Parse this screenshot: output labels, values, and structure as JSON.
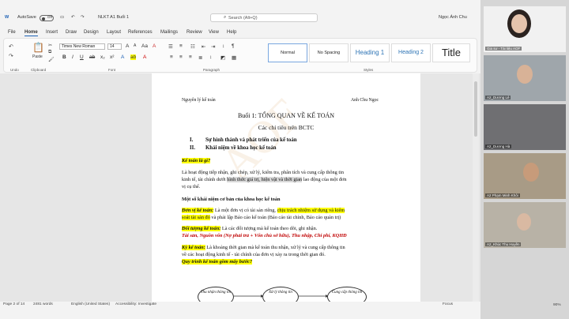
{
  "titlebar": {
    "autosave": "AutoSave",
    "autosave_state": "Off",
    "doc_title": "NLKT A1 Buổi 1",
    "search_placeholder": "Search (Alt+Q)",
    "user": "Ngọc Ánh Chu"
  },
  "menu": [
    "File",
    "Home",
    "Insert",
    "Draw",
    "Design",
    "Layout",
    "References",
    "Mailings",
    "Review",
    "View",
    "Help"
  ],
  "ribbon": {
    "paste": "Paste",
    "font_name": "Times New Roman",
    "font_size": "14",
    "styles": [
      "Normal",
      "No Spacing",
      "Heading 1",
      "Heading 2",
      "Title"
    ],
    "groups": [
      "Undo",
      "Clipboard",
      "Font",
      "Paragraph",
      "Styles"
    ]
  },
  "document": {
    "header_left": "Nguyên lý kế toán",
    "header_right": "Anh Chu Ngọc",
    "title": "Buổi 1: TỔNG QUAN VỀ KẾ TOÁN",
    "subtitle": "Các chỉ tiêu trên BCTC",
    "list1_num": "I.",
    "list1": "Sự hình thành và phát triển của kế toán",
    "list2_num": "II.",
    "list2": "Khái niệm về khoa học kế toán",
    "q1": "Kế toán là gì?",
    "p1a": "Là hoạt động tiếp nhận, ghi chép, xử lý, kiểm tra, phân tích và cung cấp thông tin",
    "p1b_pre": "kinh tế, tài chính dưới ",
    "p1b_hl": "hình thức giá trị, hiện vật và thời gian",
    "p1b_post": " lao động của một đơn",
    "p1c": "vị cụ thể.",
    "h2": "Một số khái niệm cơ bản của khoa học kế toán",
    "d1_term": "Đơn vị kế toán:",
    "d1_a": " Là một đơn vị có tài sản riêng, ",
    "d1_hl": "chịu trách nhiệm sử dụng và kiểm",
    "d1_b_hl": "soát tài sản đó",
    "d1_b": " và phải lập Báo cáo kế toán (Báo cáo tài chính, Báo cáo quản trị)",
    "d2_term": "Đối tượng kế toán:",
    "d2": " Là các đối tượng mà kế toán theo dõi, ghi nhận.",
    "d2_list": "Tài sản, Nguồn vốn (Nợ phải trả + Vốn chủ sở hữu), Thu nhập, Chi phí, KQHĐ",
    "d3_term": "Kỳ kế toán:",
    "d3a": " Là khoảng thời gian mà kế toán thu nhận, xử lý và cung cấp thông tin",
    "d3b": "về các hoạt động kinh tế - tài chính của đơn vị xảy ra trong thời gian đó.",
    "q2": "Quy trình kế toán gồm mấy bước?",
    "flow": [
      "Thu nhận thông tin",
      "Xử lý thông tin",
      "Cung cấp thông tin"
    ],
    "watermark": "AOF"
  },
  "status": {
    "page": "Page 2 of 14",
    "words": "2481 words",
    "lang": "English (United States)",
    "accessibility": "Accessibility: Investigate",
    "focus": "Focus",
    "zoom": "90%"
  },
  "participants": [
    {
      "name": "Gia sư - Tài liệu AOF"
    },
    {
      "name": "A2_Dương Lê"
    },
    {
      "name": "A2_Dương Hà"
    },
    {
      "name": "A2 Phạm Minh Khôi"
    },
    {
      "name": "A2_Khúc Thu Huyền"
    }
  ]
}
